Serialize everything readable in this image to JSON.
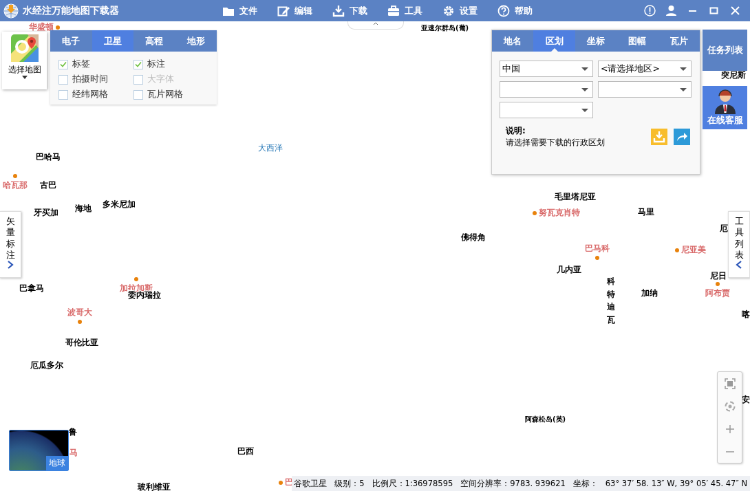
{
  "window": {
    "title": "水经注万能地图下载器"
  },
  "menu": [
    {
      "label": "文件"
    },
    {
      "label": "编辑"
    },
    {
      "label": "下载"
    },
    {
      "label": "工具"
    },
    {
      "label": "设置"
    },
    {
      "label": "帮助"
    }
  ],
  "map_selector": {
    "label": "选择地图"
  },
  "map_types": [
    {
      "label": "电子",
      "selected": false
    },
    {
      "label": "卫星",
      "selected": true
    },
    {
      "label": "高程",
      "selected": false
    },
    {
      "label": "地形",
      "selected": false
    }
  ],
  "layer_options": [
    {
      "label": "标签",
      "checked": true,
      "disabled": false
    },
    {
      "label": "标注",
      "checked": true,
      "disabled": false
    },
    {
      "label": "拍摄时间",
      "checked": false,
      "disabled": false
    },
    {
      "label": "大字体",
      "checked": false,
      "disabled": true
    },
    {
      "label": "经纬网格",
      "checked": false,
      "disabled": false
    },
    {
      "label": "瓦片网格",
      "checked": false,
      "disabled": false
    }
  ],
  "region_panel": {
    "tabs": [
      {
        "label": "地名",
        "selected": false
      },
      {
        "label": "区划",
        "selected": true
      },
      {
        "label": "坐标",
        "selected": false
      },
      {
        "label": "图幅",
        "selected": false
      },
      {
        "label": "瓦片",
        "selected": false
      }
    ],
    "dropdowns": [
      {
        "value": "中国"
      },
      {
        "value": "<请选择地区>"
      }
    ],
    "note_title": "说明:",
    "note": "请选择需要下载的行政区划"
  },
  "task_list_button": "任务列表",
  "support_button": "在线客服",
  "left_tab": "矢量标注",
  "right_tab": "工具列表",
  "globe_thumbnail": {
    "label": "地球"
  },
  "map_labels": [
    {
      "text": "华盛顿",
      "kind": "city"
    },
    {
      "text": "亚速尔群岛(葡)",
      "kind": "island"
    },
    {
      "text": "巴哈马",
      "kind": "country"
    },
    {
      "text": "哈瓦那",
      "kind": "city"
    },
    {
      "text": "古巴",
      "kind": "country"
    },
    {
      "text": "牙买加",
      "kind": "country"
    },
    {
      "text": "海地",
      "kind": "country"
    },
    {
      "text": "多米尼加",
      "kind": "country"
    },
    {
      "text": "大西洋",
      "kind": "ocean"
    },
    {
      "text": "巴拿马",
      "kind": "country"
    },
    {
      "text": "加拉加斯",
      "kind": "city"
    },
    {
      "text": "委内瑞拉",
      "kind": "country"
    },
    {
      "text": "波哥大",
      "kind": "city"
    },
    {
      "text": "哥伦比亚",
      "kind": "country"
    },
    {
      "text": "厄瓜多尔",
      "kind": "country"
    },
    {
      "text": "毛里塔尼亚",
      "kind": "country"
    },
    {
      "text": "努瓦克肖特",
      "kind": "city"
    },
    {
      "text": "马里",
      "kind": "country"
    },
    {
      "text": "佛得角",
      "kind": "country"
    },
    {
      "text": "巴马科",
      "kind": "city"
    },
    {
      "text": "尼亚美",
      "kind": "city"
    },
    {
      "text": "几内亚",
      "kind": "country"
    },
    {
      "text": "科特迪瓦",
      "kind": "vertical"
    },
    {
      "text": "加纳",
      "kind": "country"
    },
    {
      "text": "尼日",
      "kind": "country"
    },
    {
      "text": "阿布贾",
      "kind": "city"
    },
    {
      "text": "突尼斯",
      "kind": "country"
    },
    {
      "text": "喀",
      "kind": "country"
    },
    {
      "text": "安",
      "kind": "country"
    },
    {
      "text": "厄",
      "kind": "country"
    },
    {
      "text": "阿森松岛(英)",
      "kind": "island"
    },
    {
      "text": "鲁",
      "kind": "country"
    },
    {
      "text": "马",
      "kind": "city"
    },
    {
      "text": "巴西",
      "kind": "country"
    },
    {
      "text": "玻利维亚",
      "kind": "country"
    },
    {
      "text": "巴",
      "kind": "city"
    }
  ],
  "status_bar": {
    "source": "谷歌卫星",
    "level": "级别：5",
    "scale": "比例尺：1:36978595",
    "resolution": "空间分辨率：9783. 939621",
    "coord_label": "坐标：",
    "coord": "63° 37′ 58. 13″ W, 39° 05′ 45. 47″ N"
  }
}
